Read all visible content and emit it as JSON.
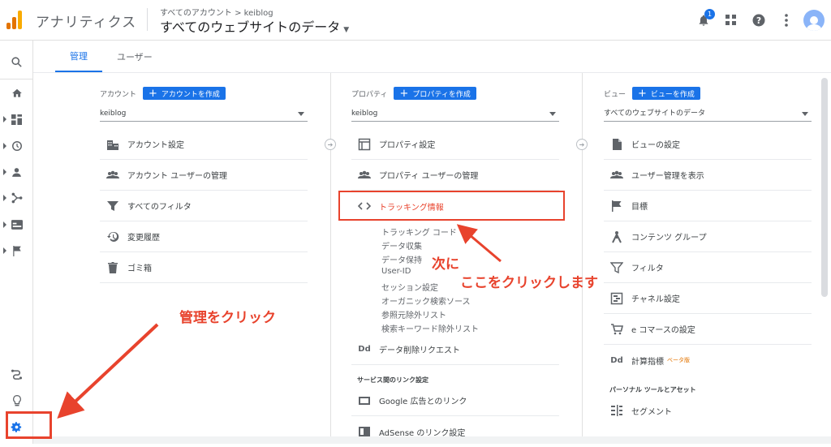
{
  "header": {
    "app_title": "アナリティクス",
    "breadcrumb": "すべてのアカウント > keiblog",
    "property_title": "すべてのウェブサイトのデータ",
    "notification_count": "1",
    "logo_colors": [
      "#f9ab00",
      "#e37400",
      "#e37400"
    ]
  },
  "leftnav": {
    "items": [
      "search-icon",
      "home-icon",
      "customization-icon",
      "realtime-icon",
      "audience-icon",
      "acquisition-icon",
      "behavior-icon",
      "conversions-icon",
      "attribution-icon",
      "discover-icon",
      "admin-gear-icon"
    ]
  },
  "tabs": [
    {
      "label": "管理",
      "active": true
    },
    {
      "label": "ユーザー",
      "active": false
    }
  ],
  "account": {
    "label": "アカウント",
    "create_label": "アカウントを作成",
    "selected": "keiblog",
    "items": [
      {
        "label": "アカウント設定",
        "icon": "building-icon"
      },
      {
        "label": "アカウント ユーザーの管理",
        "icon": "people-icon"
      },
      {
        "label": "すべてのフィルタ",
        "icon": "filter-icon"
      },
      {
        "label": "変更履歴",
        "icon": "history-icon"
      },
      {
        "label": "ゴミ箱",
        "icon": "trash-icon"
      }
    ]
  },
  "property": {
    "label": "プロパティ",
    "create_label": "プロパティを作成",
    "selected": "keiblog",
    "items": [
      {
        "label": "プロパティ設定",
        "icon": "property-icon"
      },
      {
        "label": "プロパティ ユーザーの管理",
        "icon": "people-icon"
      },
      {
        "label": "トラッキング情報",
        "icon": "code-icon"
      }
    ],
    "tracking_subitems": [
      "トラッキング コード",
      "データ収集",
      "データ保持",
      "User-ID",
      "セッション設定",
      "オーガニック検索ソース",
      "参照元除外リスト",
      "検索キーワード除外リスト"
    ],
    "data_deletion": "データ削除リクエスト",
    "links_section": "サービス間のリンク設定",
    "link_items": [
      "Google 広告とのリンク",
      "AdSense のリンク設定"
    ]
  },
  "view": {
    "label": "ビュー",
    "create_label": "ビューを作成",
    "selected": "すべてのウェブサイトのデータ",
    "items": [
      {
        "label": "ビューの設定",
        "icon": "document-icon"
      },
      {
        "label": "ユーザー管理を表示",
        "icon": "people-icon"
      },
      {
        "label": "目標",
        "icon": "flag-icon"
      },
      {
        "label": "コンテンツ グループ",
        "icon": "content-group-icon"
      },
      {
        "label": "フィルタ",
        "icon": "filter-icon"
      },
      {
        "label": "チャネル設定",
        "icon": "channel-icon"
      },
      {
        "label": "e コマースの設定",
        "icon": "cart-icon"
      },
      {
        "label": "計算指標",
        "icon": "dd-icon",
        "beta": "ベータ版"
      }
    ],
    "personal_section": "パーソナル ツールとアセット",
    "segment": "セグメント"
  },
  "annotations": {
    "admin_click": "管理をクリック",
    "next_1": "次に",
    "next_2": "ここをクリックします",
    "color": "#e8432d"
  }
}
